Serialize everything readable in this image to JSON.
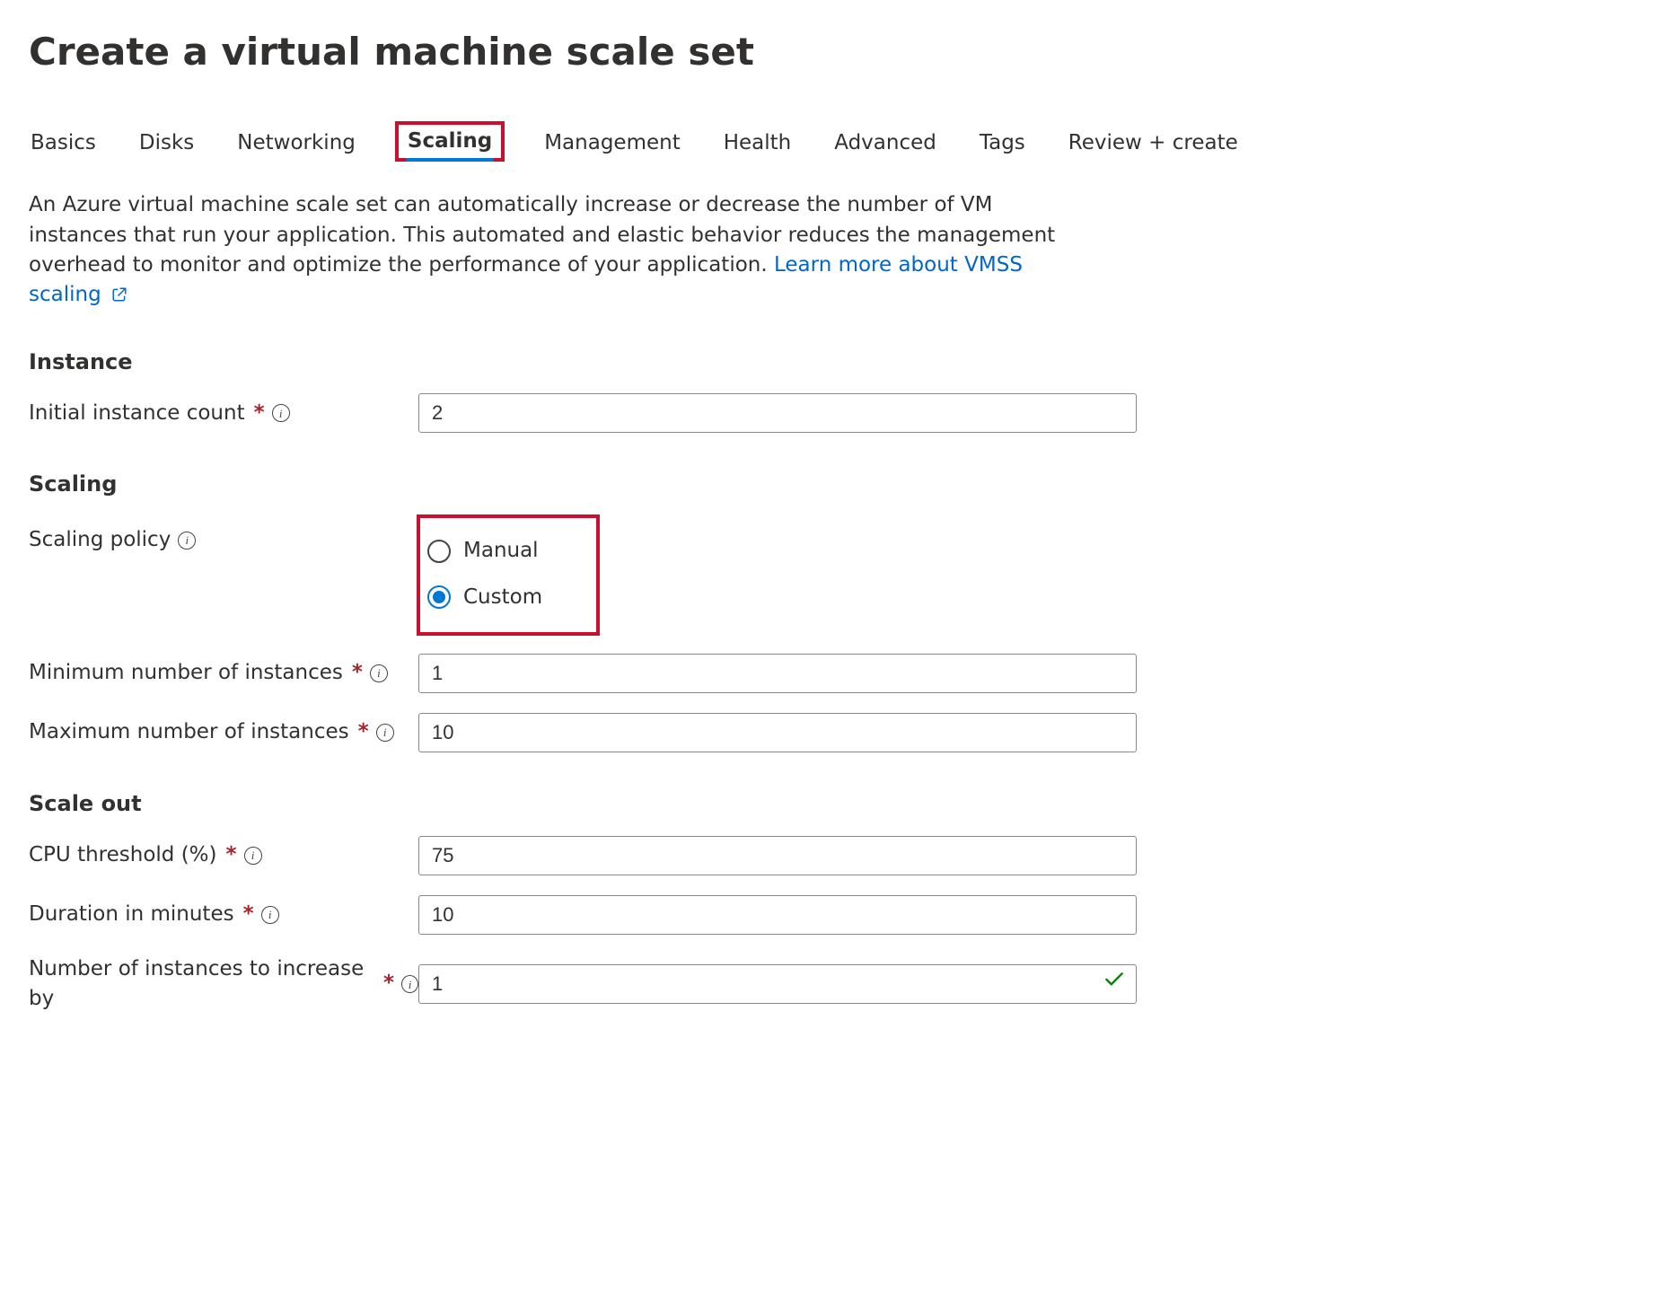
{
  "page": {
    "title": "Create a virtual machine scale set",
    "intro_part1": "An Azure virtual machine scale set can automatically increase or decrease the number of VM instances that run your application. This automated and elastic behavior reduces the management overhead to monitor and optimize the performance of your application. ",
    "learn_link": "Learn more about VMSS scaling"
  },
  "tabs": [
    {
      "id": "basics",
      "label": "Basics",
      "active": false
    },
    {
      "id": "disks",
      "label": "Disks",
      "active": false
    },
    {
      "id": "networking",
      "label": "Networking",
      "active": false
    },
    {
      "id": "scaling",
      "label": "Scaling",
      "active": true,
      "highlighted": true
    },
    {
      "id": "management",
      "label": "Management",
      "active": false
    },
    {
      "id": "health",
      "label": "Health",
      "active": false
    },
    {
      "id": "advanced",
      "label": "Advanced",
      "active": false
    },
    {
      "id": "tags",
      "label": "Tags",
      "active": false
    },
    {
      "id": "review",
      "label": "Review + create",
      "active": false
    }
  ],
  "sections": {
    "instance": {
      "heading": "Instance",
      "initial_count_label": "Initial instance count",
      "initial_count_value": "2"
    },
    "scaling": {
      "heading": "Scaling",
      "policy_label": "Scaling policy",
      "options": {
        "manual": "Manual",
        "custom": "Custom"
      },
      "selected": "custom",
      "min_label": "Minimum number of instances",
      "min_value": "1",
      "max_label": "Maximum number of instances",
      "max_value": "10"
    },
    "scale_out": {
      "heading": "Scale out",
      "cpu_label": "CPU threshold (%)",
      "cpu_value": "75",
      "duration_label": "Duration in minutes",
      "duration_value": "10",
      "increase_label": "Number of instances to increase by",
      "increase_value": "1",
      "increase_valid": true
    }
  }
}
